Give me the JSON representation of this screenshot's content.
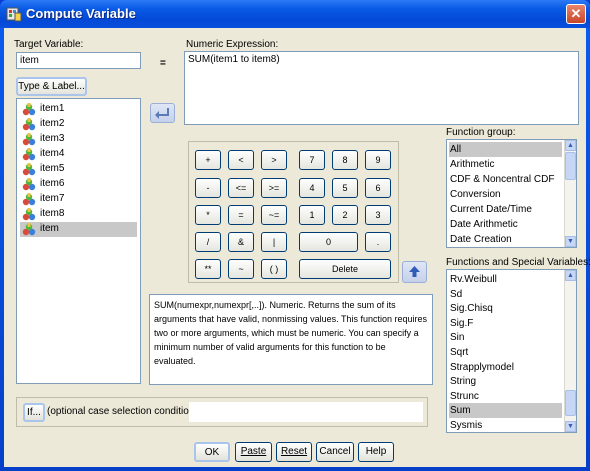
{
  "window": {
    "title": "Compute Variable",
    "close_glyph": "✕"
  },
  "target": {
    "label": "Target Variable:",
    "value": "item",
    "equals": "=",
    "type_label_button": "Type & Label..."
  },
  "expression": {
    "label": "Numeric Expression:",
    "value": "SUM(item1 to item8)"
  },
  "variables": [
    {
      "name": "item1",
      "selected": false
    },
    {
      "name": "item2",
      "selected": false
    },
    {
      "name": "item3",
      "selected": false
    },
    {
      "name": "item4",
      "selected": false
    },
    {
      "name": "item5",
      "selected": false
    },
    {
      "name": "item6",
      "selected": false
    },
    {
      "name": "item7",
      "selected": false
    },
    {
      "name": "item8",
      "selected": false
    },
    {
      "name": "item",
      "selected": true
    }
  ],
  "keypad": {
    "keys": [
      [
        "+",
        "<",
        ">",
        "7",
        "8",
        "9"
      ],
      [
        "-",
        "<=",
        ">=",
        "4",
        "5",
        "6"
      ],
      [
        "*",
        "=",
        "~=",
        "1",
        "2",
        "3"
      ],
      [
        "/",
        "&",
        "|",
        "0",
        "."
      ],
      [
        "**",
        "~",
        "( )",
        "Delete"
      ]
    ]
  },
  "function_group": {
    "label": "Function group:",
    "items": [
      "All",
      "Arithmetic",
      "CDF & Noncentral CDF",
      "Conversion",
      "Current Date/Time",
      "Date Arithmetic",
      "Date Creation"
    ],
    "selected": "All"
  },
  "functions": {
    "label": "Functions and Special Variables:",
    "items": [
      "Rv.Weibull",
      "Sd",
      "Sig.Chisq",
      "Sig.F",
      "Sin",
      "Sqrt",
      "Strapplymodel",
      "String",
      "Strunc",
      "Sum",
      "Sysmis"
    ],
    "selected": "Sum"
  },
  "description": "SUM(numexpr,numexpr[,..]). Numeric. Returns the sum of its arguments that have valid, nonmissing values. This function requires two or more arguments, which must be numeric. You can specify a minimum number of valid arguments for this function to be evaluated.",
  "if_section": {
    "button": "If...",
    "text": "(optional case selection condition)"
  },
  "buttons": {
    "ok": "OK",
    "paste": "Paste",
    "reset": "Reset",
    "cancel": "Cancel",
    "help": "Help"
  },
  "icons": {
    "move_arrow": "left-arrow-icon",
    "up_arrow": "up-arrow-icon",
    "variable": "scale-variable-icon"
  }
}
